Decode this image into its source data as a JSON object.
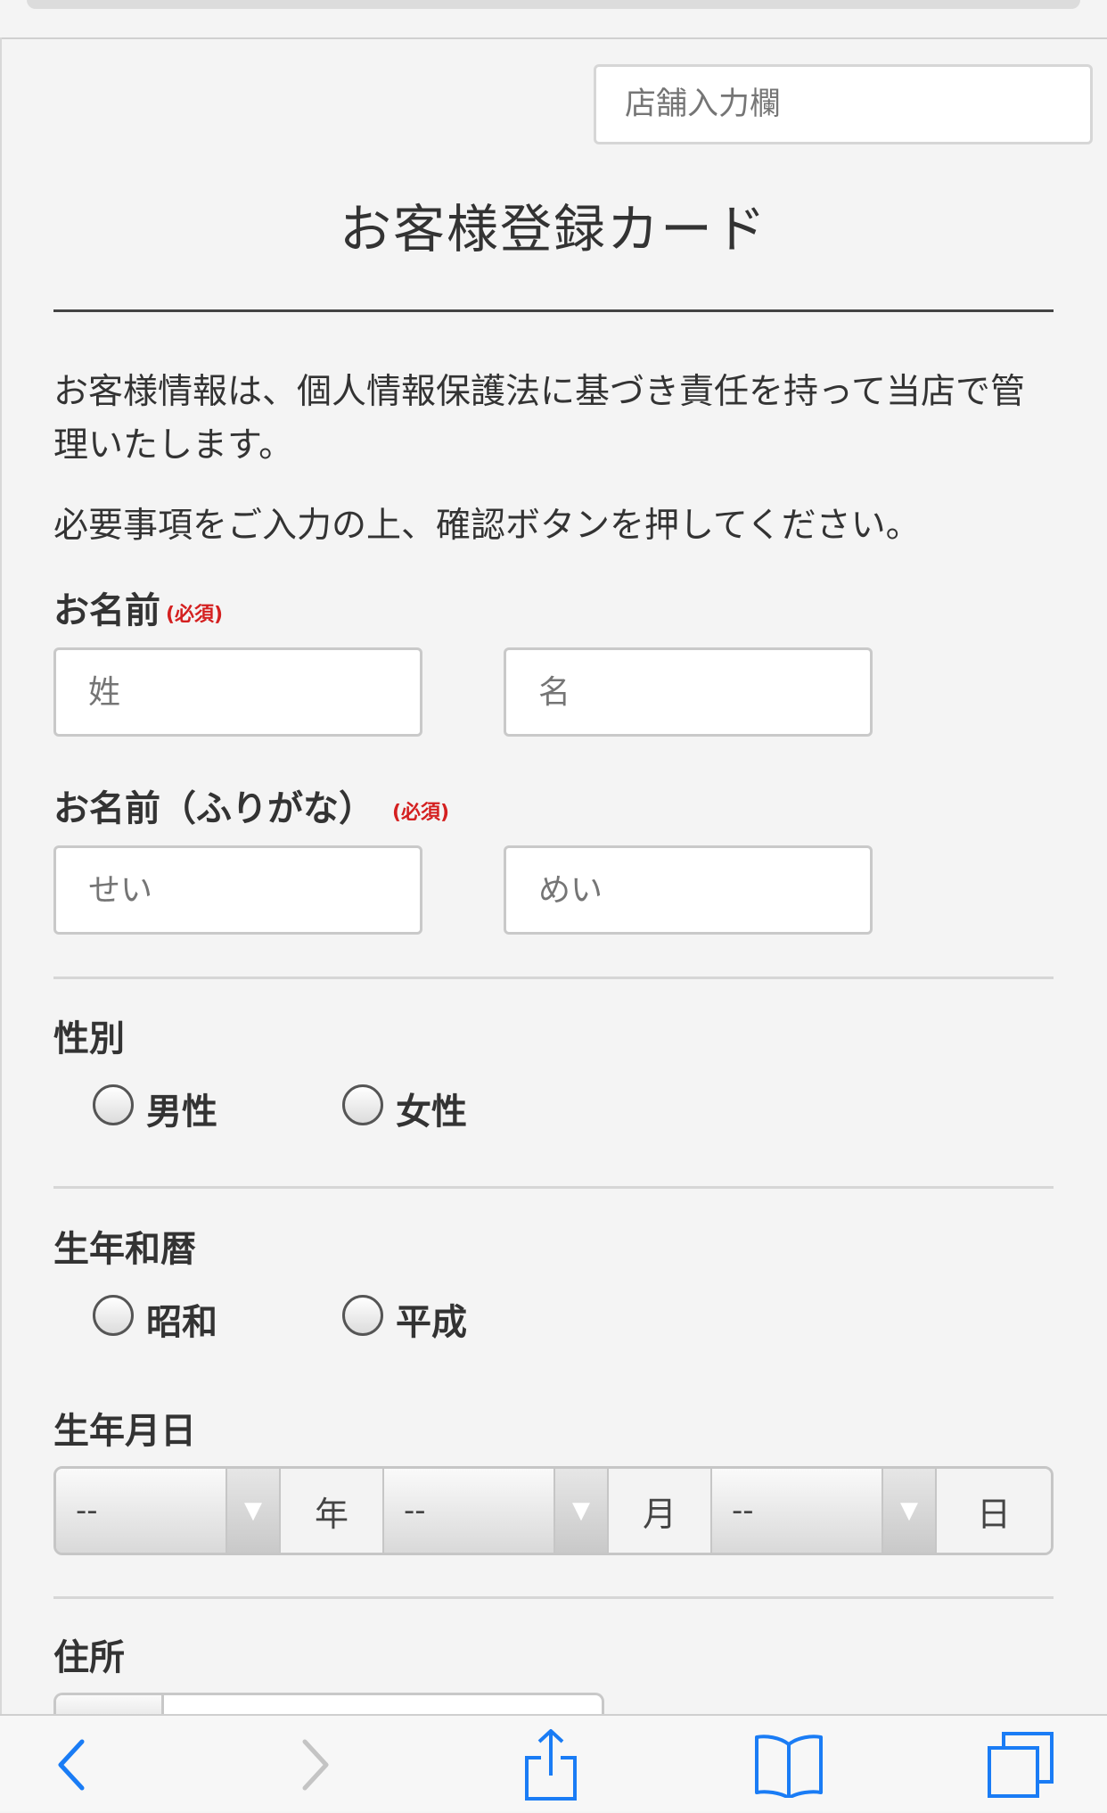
{
  "shop_input": {
    "placeholder": "店舗入力欄"
  },
  "title": "お客様登録カード",
  "intro": [
    "お客様情報は、個人情報保護法に基づき責任を持って当店で管理いたします。",
    "必要事項をご入力の上、確認ボタンを押してください。"
  ],
  "name": {
    "label": "お名前",
    "required": "(必須)",
    "last_placeholder": "姓",
    "first_placeholder": "名"
  },
  "furigana": {
    "label": "お名前（ふりがな）",
    "required": "(必須)",
    "last_placeholder": "せい",
    "first_placeholder": "めい"
  },
  "gender": {
    "label": "性別",
    "options": [
      "男性",
      "女性"
    ]
  },
  "era": {
    "label": "生年和暦",
    "options": [
      "昭和",
      "平成"
    ]
  },
  "birthday": {
    "label": "生年月日",
    "year_value": "--",
    "year_unit": "年",
    "month_value": "--",
    "month_unit": "月",
    "day_value": "--",
    "day_unit": "日"
  },
  "address": {
    "label": "住所"
  },
  "toolbar": {
    "icons": [
      "back-icon",
      "forward-icon",
      "share-icon",
      "bookmarks-icon",
      "tabs-icon"
    ]
  }
}
